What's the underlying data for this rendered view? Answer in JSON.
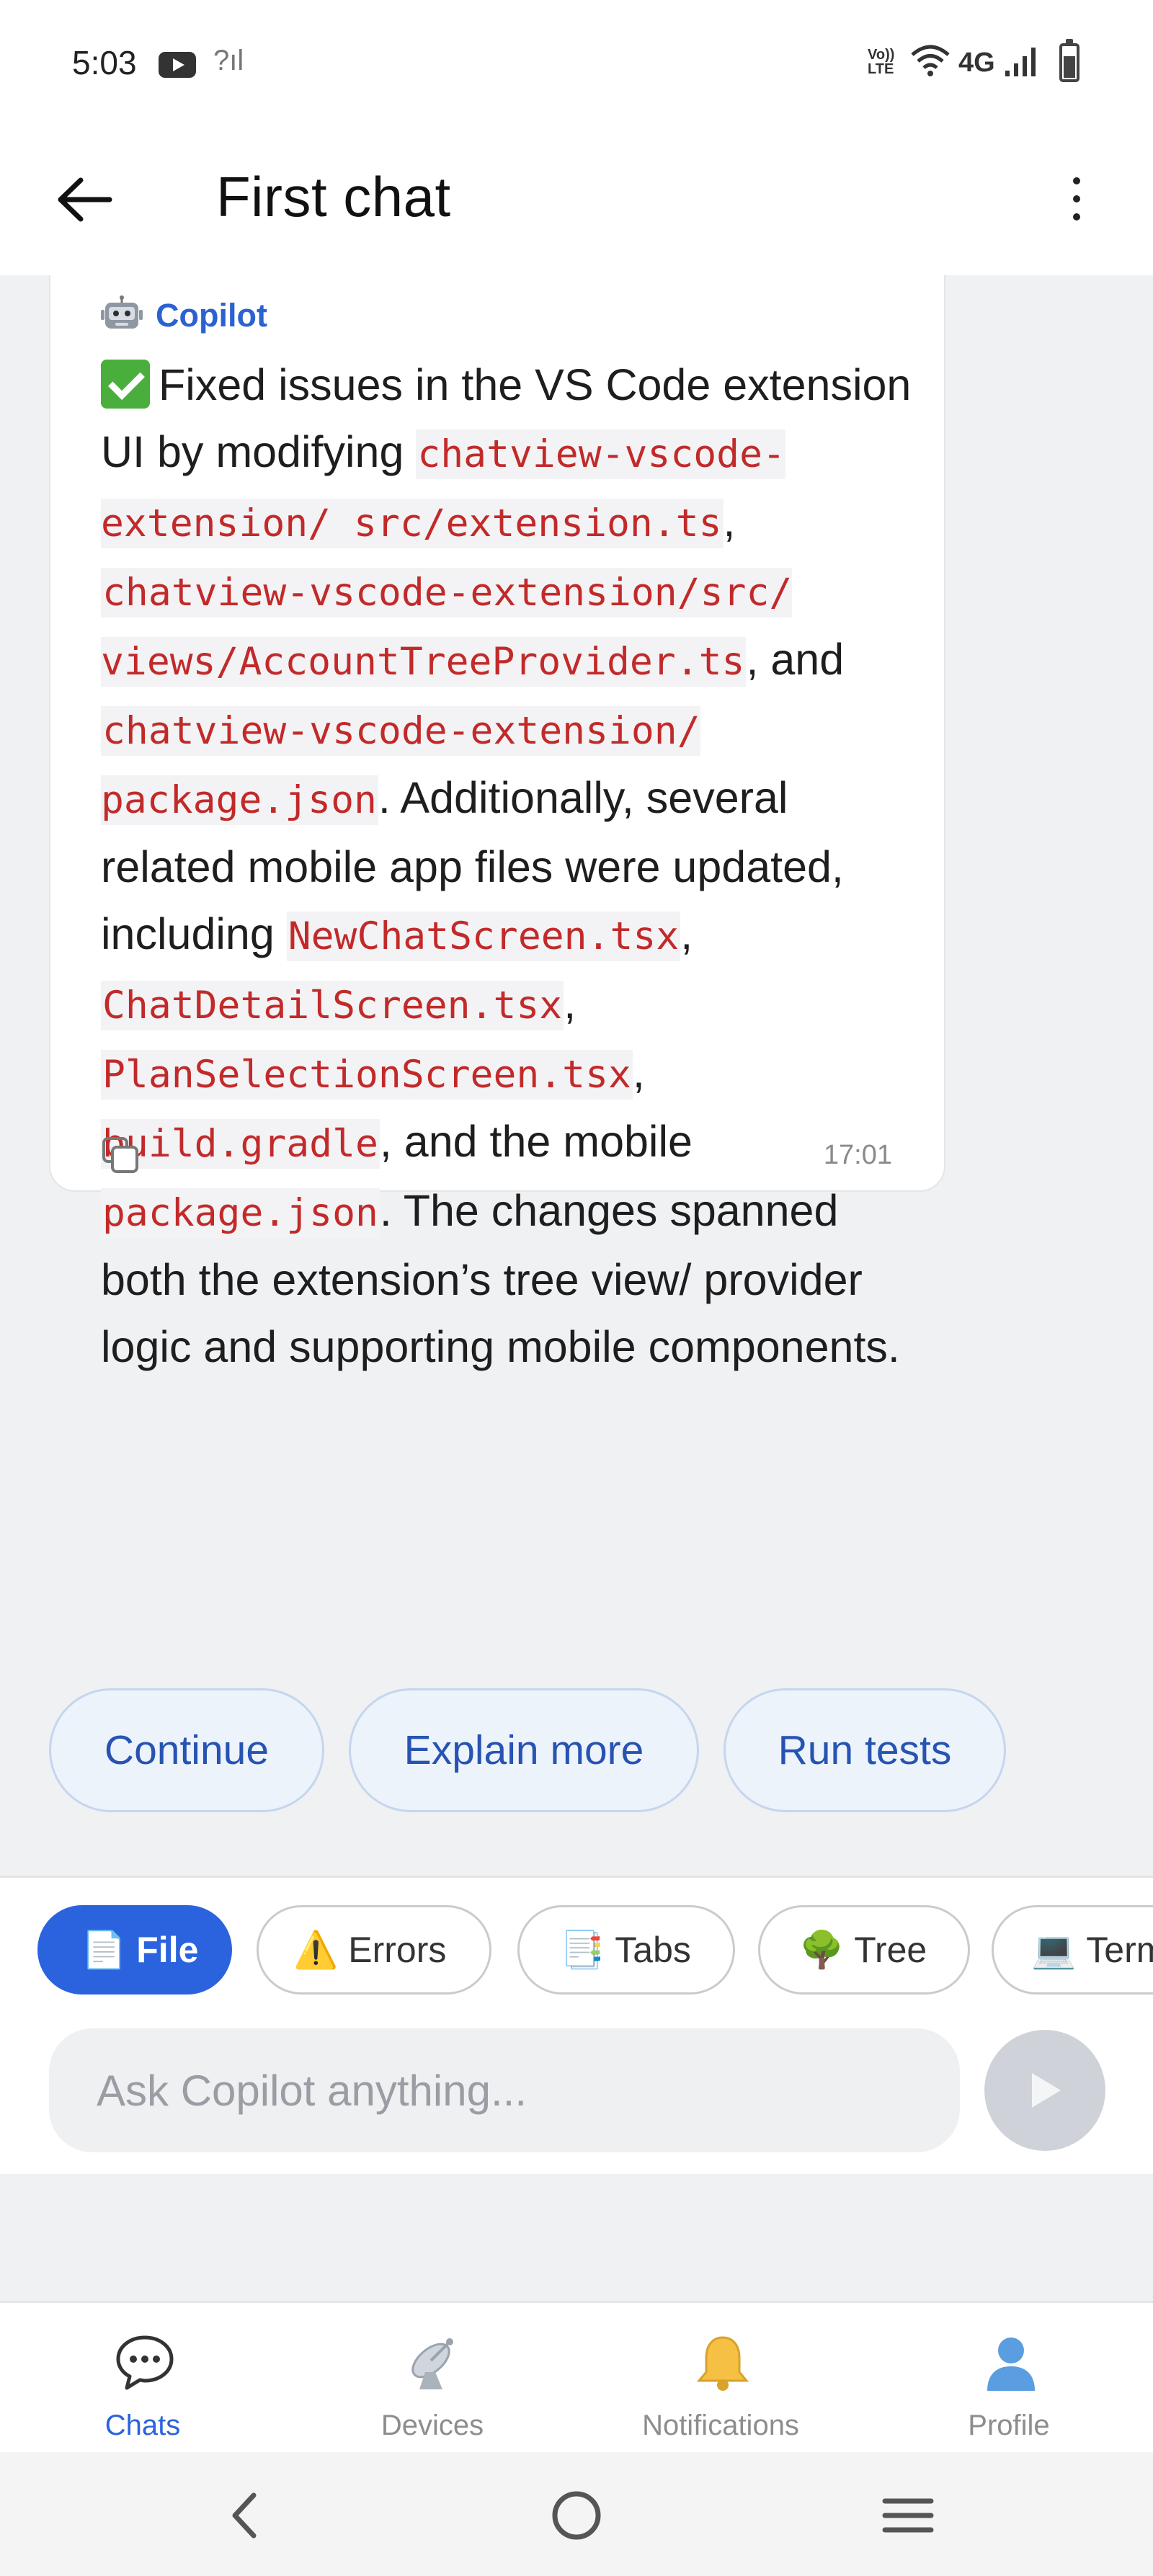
{
  "status_bar": {
    "time": "5:03",
    "network_type": "4G",
    "volte_label": "Vo)) LTE"
  },
  "header": {
    "title": "First chat"
  },
  "message": {
    "sender": "Copilot",
    "time": "17:01",
    "segments": [
      {
        "type": "text",
        "text": "Fixed issues in the VS Code extension UI by modifying "
      },
      {
        "type": "code",
        "text": "chatview-vscode-extension/ src/extension.ts"
      },
      {
        "type": "text",
        "text": ", "
      },
      {
        "type": "code",
        "text": "chatview-vscode-extension/src/ views/AccountTreeProvider.ts"
      },
      {
        "type": "text",
        "text": ", and "
      },
      {
        "type": "code",
        "text": "chatview-vscode-extension/ package.json"
      },
      {
        "type": "text",
        "text": ". Additionally, several related mobile app files were updated, including "
      },
      {
        "type": "code",
        "text": "NewChatScreen.tsx"
      },
      {
        "type": "text",
        "text": ", "
      },
      {
        "type": "code",
        "text": "ChatDetailScreen.tsx"
      },
      {
        "type": "text",
        "text": ", "
      },
      {
        "type": "code",
        "text": "PlanSelectionScreen.tsx"
      },
      {
        "type": "text",
        "text": ", "
      },
      {
        "type": "code",
        "text": "build.gradle"
      },
      {
        "type": "text",
        "text": ", and the mobile "
      },
      {
        "type": "code",
        "text": "package.json"
      },
      {
        "type": "text",
        "text": ". The changes spanned both the extension’s tree view/ provider logic and supporting mobile components."
      }
    ]
  },
  "suggestions": [
    "Continue",
    "Explain more",
    "Run tests"
  ],
  "context_chips": [
    {
      "label": "File",
      "emoji": "📄",
      "active": true
    },
    {
      "label": "Errors",
      "emoji": "⚠️",
      "active": false
    },
    {
      "label": "Tabs",
      "emoji": "📑",
      "active": false
    },
    {
      "label": "Tree",
      "emoji": "🌳",
      "active": false
    },
    {
      "label": "Term",
      "emoji": "💻",
      "active": false
    }
  ],
  "input": {
    "placeholder": "Ask Copilot anything..."
  },
  "bottom_nav": [
    {
      "label": "Chats",
      "icon": "chat-bubble-icon",
      "active": true
    },
    {
      "label": "Devices",
      "icon": "satellite-dish-icon",
      "active": false
    },
    {
      "label": "Notifications",
      "icon": "bell-icon",
      "active": false
    },
    {
      "label": "Profile",
      "icon": "person-icon",
      "active": false
    }
  ],
  "colors": {
    "accent": "#2b63de",
    "code_text": "#c22a2a",
    "sender": "#2b62d2"
  }
}
